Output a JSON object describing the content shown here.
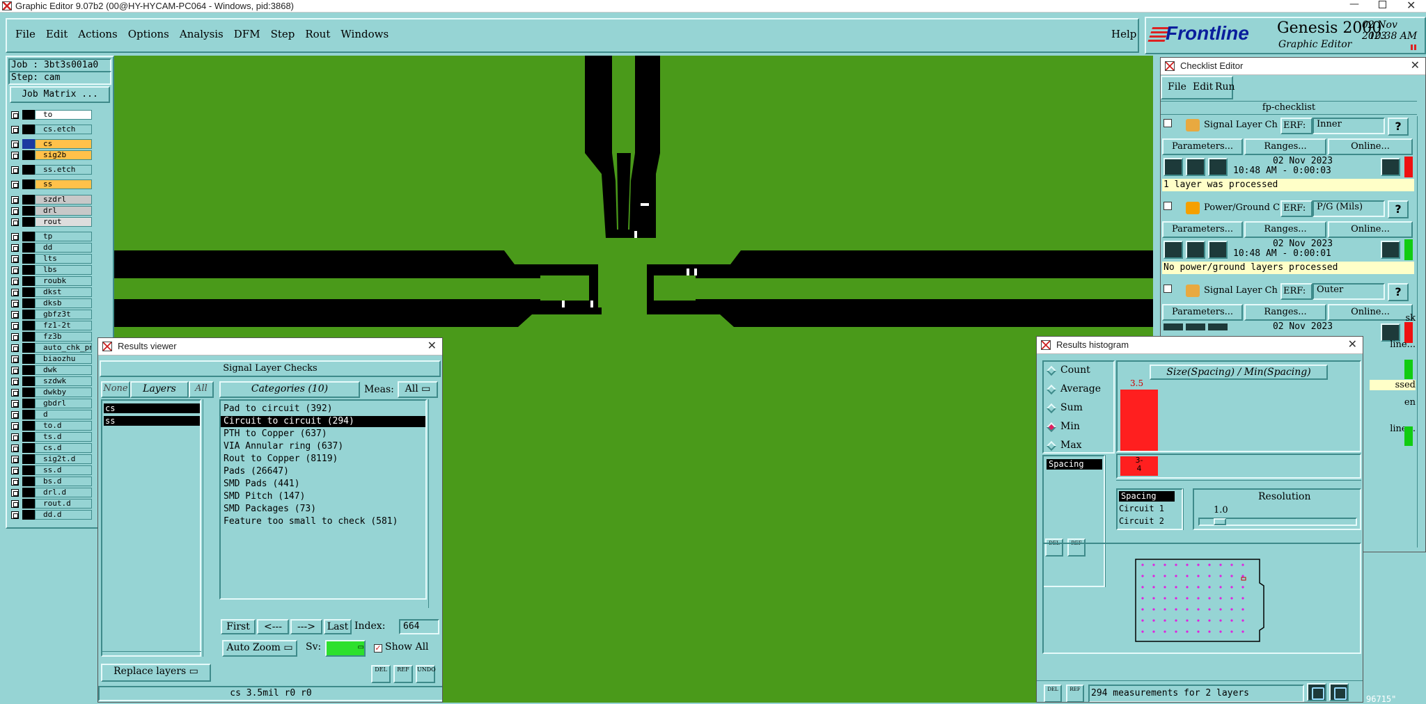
{
  "app": {
    "title": "Graphic Editor 9.07b2 (00@HY-HYCAM-PC064 - Windows, pid:3868)",
    "brand": "Frontline",
    "product": "Genesis 2000",
    "subtitle": "Graphic Editor",
    "date": "02 Nov 2023",
    "time": "10:38 AM"
  },
  "menu": {
    "items": [
      "File",
      "Edit",
      "Actions",
      "Options",
      "Analysis",
      "DFM",
      "Step",
      "Rout",
      "Windows"
    ],
    "help": "Help"
  },
  "job": {
    "job_label": "Job : 3bt3s001a0",
    "step_label": "Step: cam",
    "matrix_button": "Job Matrix ..."
  },
  "layers": [
    {
      "name": "to",
      "color": "#ffffff"
    },
    {
      "name": "cs.etch",
      "color": "#96d4d4"
    },
    {
      "name": "cs",
      "color": "#ffc14a"
    },
    {
      "name": "sig2b",
      "color": "#ffc14a"
    },
    {
      "name": "ss.etch",
      "color": "#96d4d4"
    },
    {
      "name": "ss",
      "color": "#ffc14a"
    },
    {
      "name": "szdrl",
      "color": "#c8c8c8"
    },
    {
      "name": "drl",
      "color": "#c8c8c8"
    },
    {
      "name": "rout",
      "color": "#dddddd"
    },
    {
      "name": "tp",
      "color": "#96d4d4"
    },
    {
      "name": "dd",
      "color": "#96d4d4"
    },
    {
      "name": "lts",
      "color": "#96d4d4"
    },
    {
      "name": "lbs",
      "color": "#96d4d4"
    },
    {
      "name": "roubk",
      "color": "#96d4d4"
    },
    {
      "name": "dkst",
      "color": "#96d4d4"
    },
    {
      "name": "dksb",
      "color": "#96d4d4"
    },
    {
      "name": "gbfz3t",
      "color": "#96d4d4"
    },
    {
      "name": "fz1-2t",
      "color": "#96d4d4"
    },
    {
      "name": "fz3b",
      "color": "#96d4d4"
    },
    {
      "name": "auto_chk_pn",
      "color": "#96d4d4"
    },
    {
      "name": "biaozhu",
      "color": "#96d4d4"
    },
    {
      "name": "dwk",
      "color": "#96d4d4"
    },
    {
      "name": "szdwk",
      "color": "#96d4d4"
    },
    {
      "name": "dwkby",
      "color": "#96d4d4"
    },
    {
      "name": "gbdrl",
      "color": "#96d4d4"
    },
    {
      "name": "d",
      "color": "#96d4d4"
    },
    {
      "name": "to.d",
      "color": "#96d4d4"
    },
    {
      "name": "ts.d",
      "color": "#96d4d4"
    },
    {
      "name": "cs.d",
      "color": "#96d4d4"
    },
    {
      "name": "sig2t.d",
      "color": "#96d4d4"
    },
    {
      "name": "ss.d",
      "color": "#96d4d4"
    },
    {
      "name": "bs.d",
      "color": "#96d4d4"
    },
    {
      "name": "drl.d",
      "color": "#96d4d4"
    },
    {
      "name": "rout.d",
      "color": "#96d4d4"
    },
    {
      "name": "dd.d",
      "color": "#96d4d4"
    }
  ],
  "checklist": {
    "title": "Checklist Editor",
    "menu": [
      "File",
      "Edit",
      "Run"
    ],
    "name": "fp-checklist",
    "erf_label": "ERF:",
    "params_label": "Parameters...",
    "ranges_label": "Ranges...",
    "online_label": "Online...",
    "items": [
      {
        "name": "Signal Layer Ch",
        "erf": "Inner",
        "date": "02 Nov 2023",
        "time": "10:48 AM - 0:00:03",
        "status": "1 layer was processed"
      },
      {
        "name": "Power/Ground C",
        "erf": "P/G (Mils)",
        "date": "02 Nov 2023",
        "time": "10:48 AM - 0:00:01",
        "status": "No power/ground layers processed"
      },
      {
        "name": "Signal Layer Ch",
        "erf": "Outer",
        "date": "02 Nov 2023",
        "time": "",
        "status": ""
      }
    ],
    "partial": [
      "sk",
      "line...",
      "ssed",
      "en",
      "line..."
    ]
  },
  "results_viewer": {
    "title": "Results viewer",
    "header": "Signal Layer Checks",
    "none_label": "None",
    "layers_label": "Layers",
    "all_label": "All",
    "categories_label": "Categories (10)",
    "meas_label": "Meas:",
    "meas_value": "All",
    "layers": [
      "cs",
      "ss"
    ],
    "categories": [
      "Pad to circuit (392)",
      "Circuit to circuit (294)",
      "PTH to Copper (637)",
      "VIA Annular ring (637)",
      "Rout to Copper (8119)",
      "Pads (26647)",
      "SMD Pads (441)",
      "SMD Pitch (147)",
      "SMD Packages (73)",
      "Feature too small to check (581)"
    ],
    "first_label": "First",
    "prev_label": "<---",
    "next_label": "--->",
    "last_label": "Last",
    "index_label": "Index:",
    "index_value": "664",
    "auto_zoom_label": "Auto Zoom",
    "sv_label": "Sv:",
    "show_all_label": "Show All",
    "replace_layers_label": "Replace layers",
    "icon_labels": [
      "DEL",
      "REF",
      "UNDO"
    ],
    "status": "cs 3.5mil  r0  r0"
  },
  "histogram": {
    "title": "Results histogram",
    "options": [
      "Count",
      "Average",
      "Sum",
      "Min",
      "Max"
    ],
    "selected_option": "Min",
    "list_item": "Spacing",
    "chart_title": "Size(Spacing) / Min(Spacing)",
    "bar_value_label": "3.5",
    "bin_label_top": "3-",
    "bin_label_bottom": "4",
    "columns": [
      "Spacing",
      "Circuit 1",
      "Circuit 2"
    ],
    "resolution_label": "Resolution",
    "resolution_value": "1.0",
    "measurements_text": "294 measurements for 2 layers",
    "icon_labels": [
      "DEL",
      "REF"
    ]
  },
  "colors": {
    "board_green": "#4a9a1a",
    "panel_cyan": "#96d4d4",
    "trace_black": "#000000",
    "alert_red": "#ee1111"
  },
  "bottom_right_partial": "96715\""
}
